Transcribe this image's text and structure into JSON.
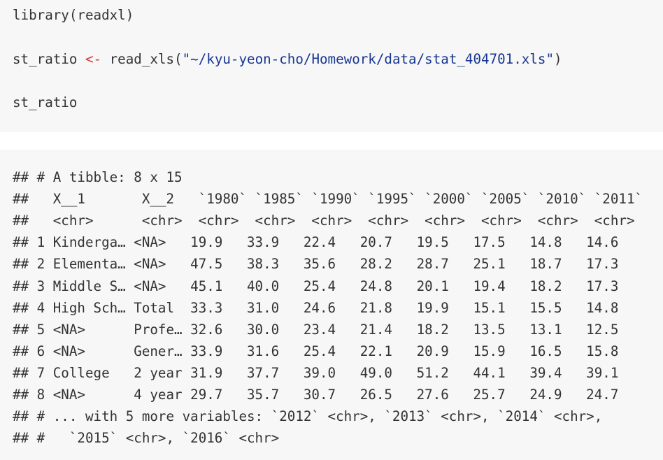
{
  "source": {
    "line1": "library(readxl)",
    "line2_var": "st_ratio ",
    "line2_op": "<-",
    "line2_call": " read_xls(",
    "line2_string": "\"~/kyu-yeon-cho/Homework/data/stat_404701.xls\"",
    "line2_close": ")",
    "line3": "st_ratio"
  },
  "output": {
    "lines": [
      "## # A tibble: 8 x 15",
      "##   X__1       X__2   `1980` `1985` `1990` `1995` `2000` `2005` `2010` `2011`",
      "##   <chr>      <chr>  <chr>  <chr>  <chr>  <chr>  <chr>  <chr>  <chr>  <chr>",
      "## 1 Kinderga… <NA>   19.9   33.9   22.4   20.7   19.5   17.5   14.8   14.6",
      "## 2 Elementa… <NA>   47.5   38.3   35.6   28.2   28.7   25.1   18.7   17.3",
      "## 3 Middle S… <NA>   45.1   40.0   25.4   24.8   20.1   19.4   18.2   17.3",
      "## 4 High Sch… Total  33.3   31.0   24.6   21.8   19.9   15.1   15.5   14.8",
      "## 5 <NA>      Profe… 32.6   30.0   23.4   21.4   18.2   13.5   13.1   12.5",
      "## 6 <NA>      Gener… 33.9   31.6   25.4   22.1   20.9   15.9   16.5   15.8",
      "## 7 College   2 year 31.9   37.7   39.0   49.0   51.2   44.1   39.4   39.1",
      "## 8 <NA>      4 year 29.7   35.7   30.7   26.5   27.6   25.7   24.9   24.7",
      "## # ... with 5 more variables: `2012` <chr>, `2013` <chr>, `2014` <chr>,",
      "## #   `2015` <chr>, `2016` <chr>"
    ]
  }
}
